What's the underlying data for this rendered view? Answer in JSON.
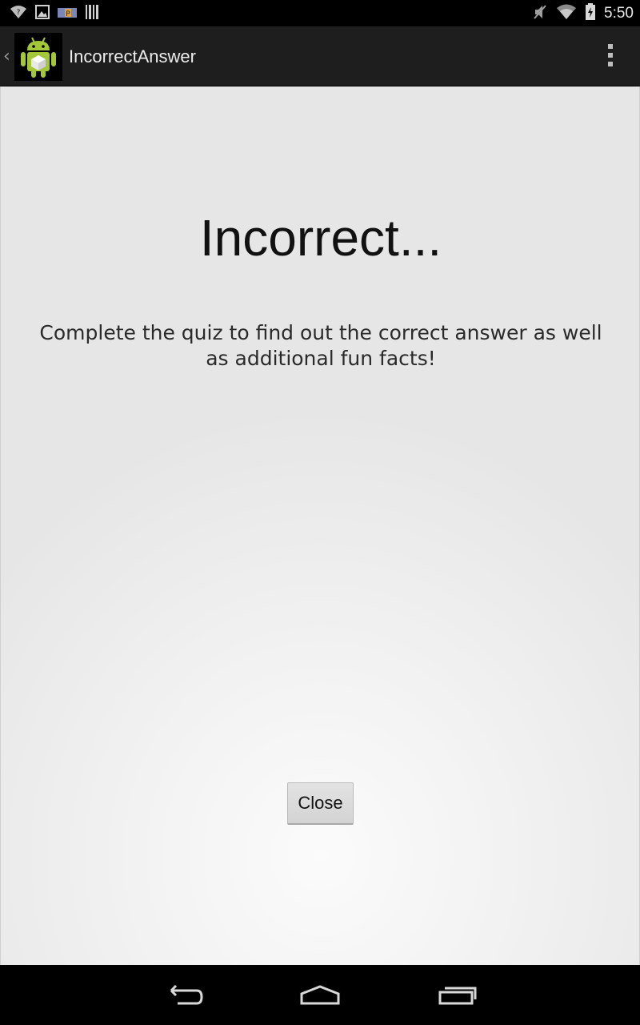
{
  "status_bar": {
    "left_icons": [
      "wifi-question-icon",
      "gallery-icon",
      "p-badge-icon",
      "barcode-icon"
    ],
    "right_icons": [
      "mute-icon",
      "wifi-icon",
      "battery-charging-icon"
    ],
    "time": "5:50"
  },
  "action_bar": {
    "title": "IncorrectAnswer",
    "up_glyph": "‹"
  },
  "content": {
    "headline": "Incorrect...",
    "message": "Complete the quiz to find out the correct answer as well as additional fun facts!",
    "close_label": "Close"
  },
  "nav_bar": {
    "buttons": [
      "back-icon",
      "home-icon",
      "recents-icon"
    ]
  },
  "colors": {
    "android_green": "#a4c639",
    "action_bar_bg": "#1e1e1e",
    "content_bg": "#ececec"
  }
}
